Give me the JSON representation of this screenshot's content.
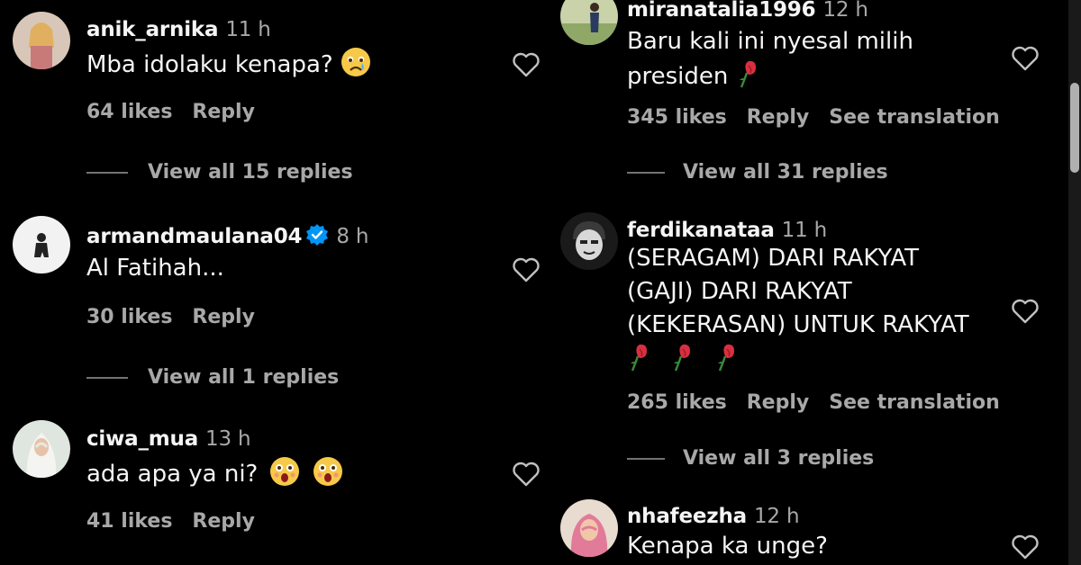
{
  "left_comments": [
    {
      "username": "anik_arnika",
      "time": "11 h",
      "text": "Mba idolaku kenapa?",
      "likes": "64 likes",
      "reply": "Reply",
      "view_replies": "View all 15 replies"
    },
    {
      "username": "armandmaulana04",
      "time": "8 h",
      "text": "Al Fatihah...",
      "likes": "30 likes",
      "reply": "Reply",
      "view_replies": "View all 1 replies"
    },
    {
      "username": "ciwa_mua",
      "time": "13 h",
      "text": "ada apa ya ni?",
      "likes": "41 likes",
      "reply": "Reply"
    }
  ],
  "right_comments": [
    {
      "username": "miranatalia1996",
      "time": "12 h",
      "text_line1": "Baru kali ini nyesal milih",
      "text_line2": "presiden",
      "likes": "345 likes",
      "reply": "Reply",
      "see_translation": "See translation",
      "view_replies": "View all 31 replies"
    },
    {
      "username": "ferdikanataa",
      "time": "11 h",
      "text_line1": "(SERAGAM) DARI RAKYAT",
      "text_line2": "(GAJI) DARI RAKYAT",
      "text_line3": "(KEKERASAN) UNTUK RAKYAT",
      "likes": "265 likes",
      "reply": "Reply",
      "see_translation": "See translation",
      "view_replies": "View all 3 replies"
    },
    {
      "username": "nhafeezha",
      "time": "12 h",
      "text": "Kenapa ka unge?"
    }
  ],
  "icons": {
    "like": "heart-outline-icon",
    "verified": "verified-badge-icon",
    "sad_emoji": "sad-face-emoji",
    "shocked_emoji": "shocked-face-emoji",
    "rose": "wilted-rose-emoji"
  },
  "colors": {
    "background": "#000000",
    "text": "#f5f5f5",
    "secondary": "#a8a8a8",
    "verified": "#0095f6"
  }
}
